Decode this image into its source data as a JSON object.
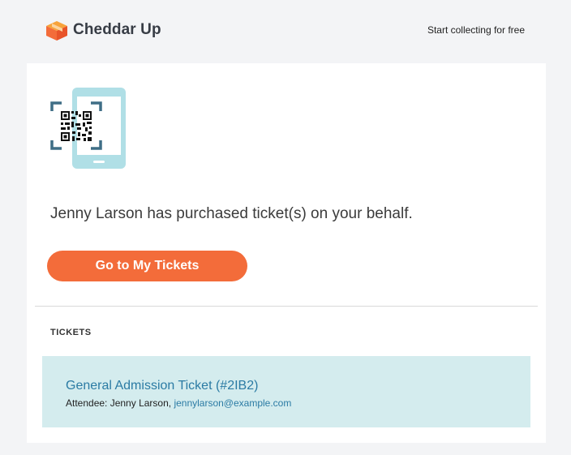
{
  "brand": {
    "name": "Cheddar Up",
    "accent": "#f36c3a"
  },
  "header": {
    "link_label": "Start collecting for free"
  },
  "message": "Jenny Larson has purchased ticket(s) on your behalf.",
  "cta_label": "Go to My Tickets",
  "tickets_section": {
    "title": "TICKETS",
    "items": [
      {
        "name": "General Admission Ticket (#2IB2)",
        "attendee_label": "Attendee: Jenny Larson,",
        "attendee_email": "jennylarson@example.com"
      }
    ]
  },
  "icons": {
    "logo": "cheddar-up-logo-icon",
    "hero": "qr-code-phone-icon"
  }
}
